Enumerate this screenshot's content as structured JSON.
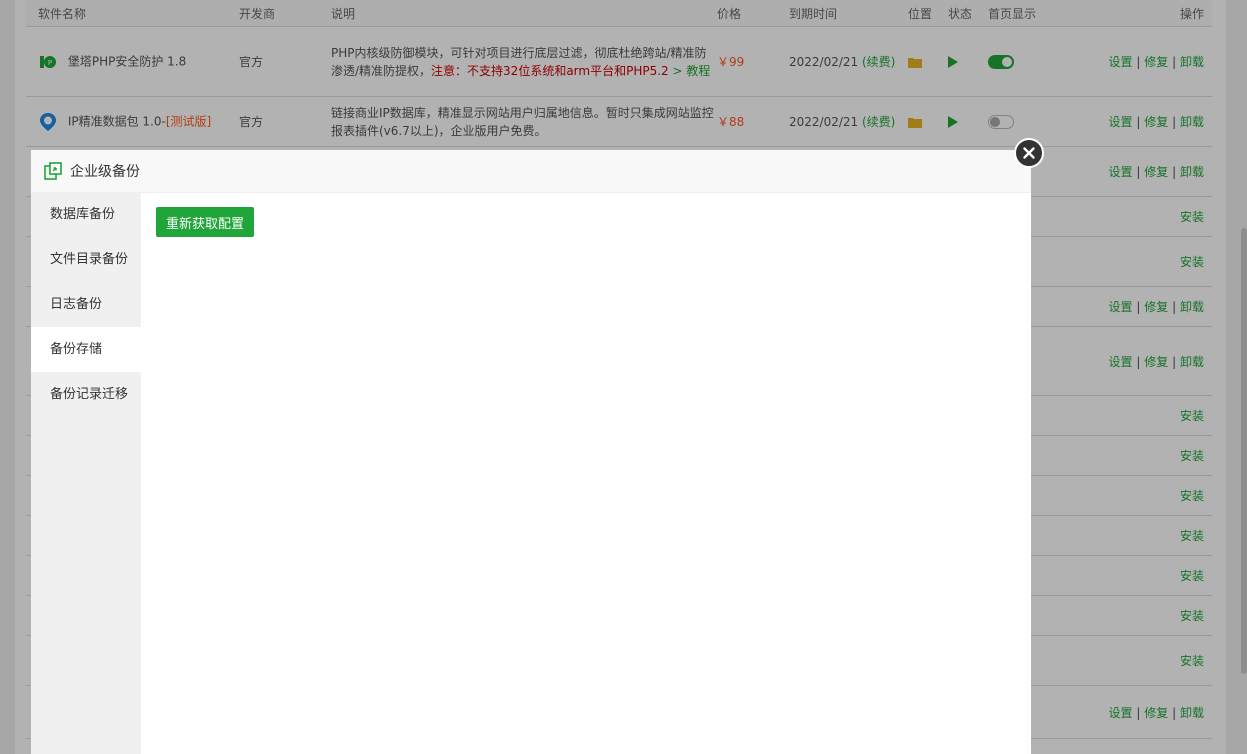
{
  "table": {
    "headers": [
      "软件名称",
      "开发商",
      "说明",
      "价格",
      "到期时间",
      "位置",
      "状态",
      "首页显示",
      "操作"
    ],
    "row1": {
      "name": "堡塔PHP安全防护 1.8",
      "dev": "官方",
      "desc": "PHP内核级防御模块，可针对项目进行底层过滤，彻底杜绝跨站/精准防渗透/精准防提权，",
      "desc_warn": "注意：不支持32位系统和arm平台和PHP5.2",
      "desc_link": " > 教程",
      "price": "￥99",
      "expire": "2022/02/21",
      "renew": "(续费)"
    },
    "row2": {
      "name": "IP精准数据包 1.0-",
      "name_tag": "[测试版]",
      "dev": "官方",
      "desc": "链接商业IP数据库，精准显示网站用户归属地信息。暂时只集成网站监控报表插件(v6.7以上)，企业版用户免费。",
      "price": "￥88",
      "expire": "2022/02/21",
      "renew": "(续费)"
    },
    "op_set": "设置",
    "op_fix": "修复",
    "op_uninstall": "卸载",
    "op_sep": "|",
    "op_install": "安装"
  },
  "modal": {
    "title": "企业级备份",
    "sidebar": [
      "数据库备份",
      "文件目录备份",
      "日志备份",
      "备份存储",
      "备份记录迁移"
    ],
    "active_index": 3,
    "button_label": "重新获取配置"
  },
  "colors": {
    "accent": "#20a53a",
    "warn": "#cc0000",
    "price": "#ff5722"
  },
  "icons": [
    "shield-php-icon",
    "location-pin-icon",
    "folder-icon",
    "play-icon",
    "toggle-icon",
    "backup-icon",
    "close-icon"
  ]
}
